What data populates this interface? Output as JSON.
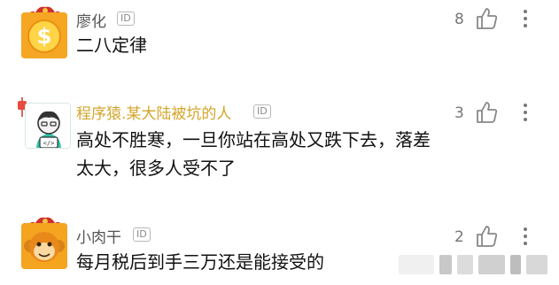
{
  "comments": [
    {
      "username": "廖化",
      "id_badge": "ID",
      "text": "二八定律",
      "likes": "8",
      "avatar_icon": "dollar-coin-icon",
      "username_color": "#555555"
    },
    {
      "username": "程序猿.某大陆被坑的人",
      "id_badge": "ID",
      "text_line1": "高处不胜寒，一旦你站在高处又跌下去，落差",
      "text_line2": "太大，很多人受不了",
      "likes": "3",
      "avatar_icon": "coder-character-icon",
      "username_color": "#d4a52a"
    },
    {
      "username": "小肉干",
      "id_badge": "ID",
      "text": "每月税后到手三万还是能接受的",
      "likes": "2",
      "avatar_icon": "monkey-face-icon",
      "username_color": "#555555"
    }
  ],
  "icons": {
    "like": "thumbs-up-icon",
    "more": "vertical-dots-icon"
  }
}
